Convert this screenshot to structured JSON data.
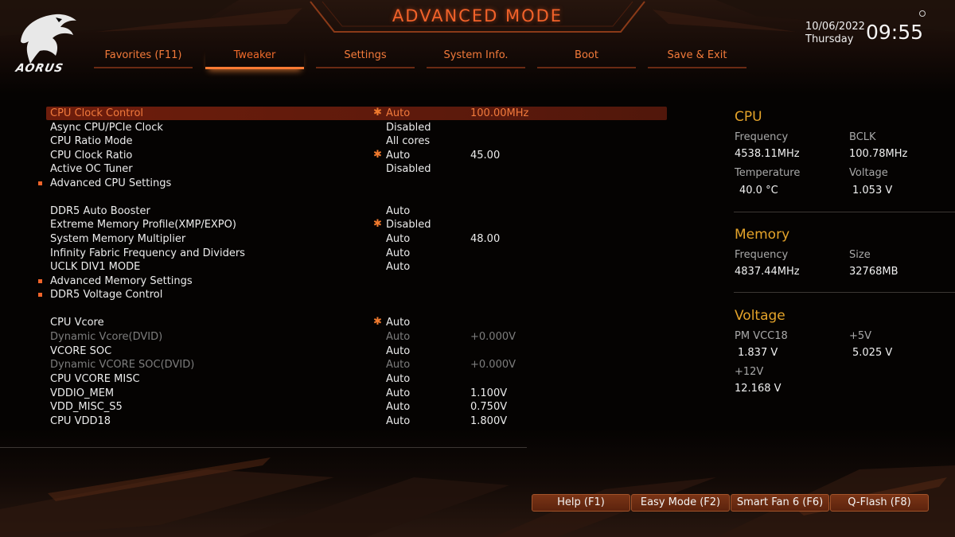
{
  "header": {
    "title": "ADVANCED MODE",
    "brand": "AORUS",
    "date": "10/06/2022",
    "day": "Thursday",
    "time": "09:55",
    "accent": "#f2622a"
  },
  "tabs": [
    {
      "label": "Favorites (F11)",
      "active": false
    },
    {
      "label": "Tweaker",
      "active": true
    },
    {
      "label": "Settings",
      "active": false
    },
    {
      "label": "System Info.",
      "active": false
    },
    {
      "label": "Boot",
      "active": false
    },
    {
      "label": "Save & Exit",
      "active": false
    }
  ],
  "settings": {
    "r0": {
      "label": "CPU Clock Control",
      "value": "Auto",
      "value2": "100.00MHz"
    },
    "r1": {
      "label": "Async CPU/PCIe Clock",
      "value": "Disabled"
    },
    "r2": {
      "label": "CPU Ratio Mode",
      "value": "All cores"
    },
    "r3": {
      "label": "CPU Clock Ratio",
      "value": "Auto",
      "value2": "45.00"
    },
    "r4": {
      "label": "Active OC Tuner",
      "value": "Disabled"
    },
    "r5": {
      "label": "Advanced CPU Settings"
    },
    "r6": {
      "label": "DDR5 Auto Booster",
      "value": "Auto"
    },
    "r7": {
      "label": "Extreme Memory Profile(XMP/EXPO)",
      "value": "Disabled"
    },
    "r8": {
      "label": "System Memory Multiplier",
      "value": "Auto",
      "value2": "48.00"
    },
    "r9": {
      "label": "Infinity Fabric Frequency and Dividers",
      "value": "Auto"
    },
    "r10": {
      "label": "UCLK DIV1 MODE",
      "value": "Auto"
    },
    "r11": {
      "label": "Advanced Memory Settings"
    },
    "r12": {
      "label": "DDR5 Voltage Control"
    },
    "r13": {
      "label": "CPU Vcore",
      "value": "Auto"
    },
    "r14": {
      "label": "Dynamic Vcore(DVID)",
      "value": "Auto",
      "value2": "+0.000V"
    },
    "r15": {
      "label": "VCORE SOC",
      "value": "Auto"
    },
    "r16": {
      "label": "Dynamic VCORE SOC(DVID)",
      "value": "Auto",
      "value2": "+0.000V"
    },
    "r17": {
      "label": "CPU VCORE MISC",
      "value": "Auto"
    },
    "r18": {
      "label": "VDDIO_MEM",
      "value": "Auto",
      "value2": "1.100V"
    },
    "r19": {
      "label": "VDD_MISC_S5",
      "value": "Auto",
      "value2": "0.750V"
    },
    "r20": {
      "label": "CPU VDD18",
      "value": "Auto",
      "value2": "1.800V"
    }
  },
  "info": {
    "cpu": {
      "title": "CPU",
      "freq_label": "Frequency",
      "freq": "4538.11MHz",
      "bclk_label": "BCLK",
      "bclk": "100.78MHz",
      "temp_label": "Temperature",
      "temp": "40.0 °C",
      "volt_label": "Voltage",
      "volt": "1.053 V"
    },
    "memory": {
      "title": "Memory",
      "freq_label": "Frequency",
      "freq": "4837.44MHz",
      "size_label": "Size",
      "size": "32768MB"
    },
    "voltage": {
      "title": "Voltage",
      "pm_label": "PM VCC18",
      "pm": "1.837 V",
      "p5_label": "+5V",
      "p5": "5.025 V",
      "p12_label": "+12V",
      "p12": "12.168 V"
    }
  },
  "footer": {
    "help": "Help (F1)",
    "easy": "Easy Mode (F2)",
    "fan": "Smart Fan 6 (F6)",
    "qflash": "Q-Flash (F8)"
  }
}
